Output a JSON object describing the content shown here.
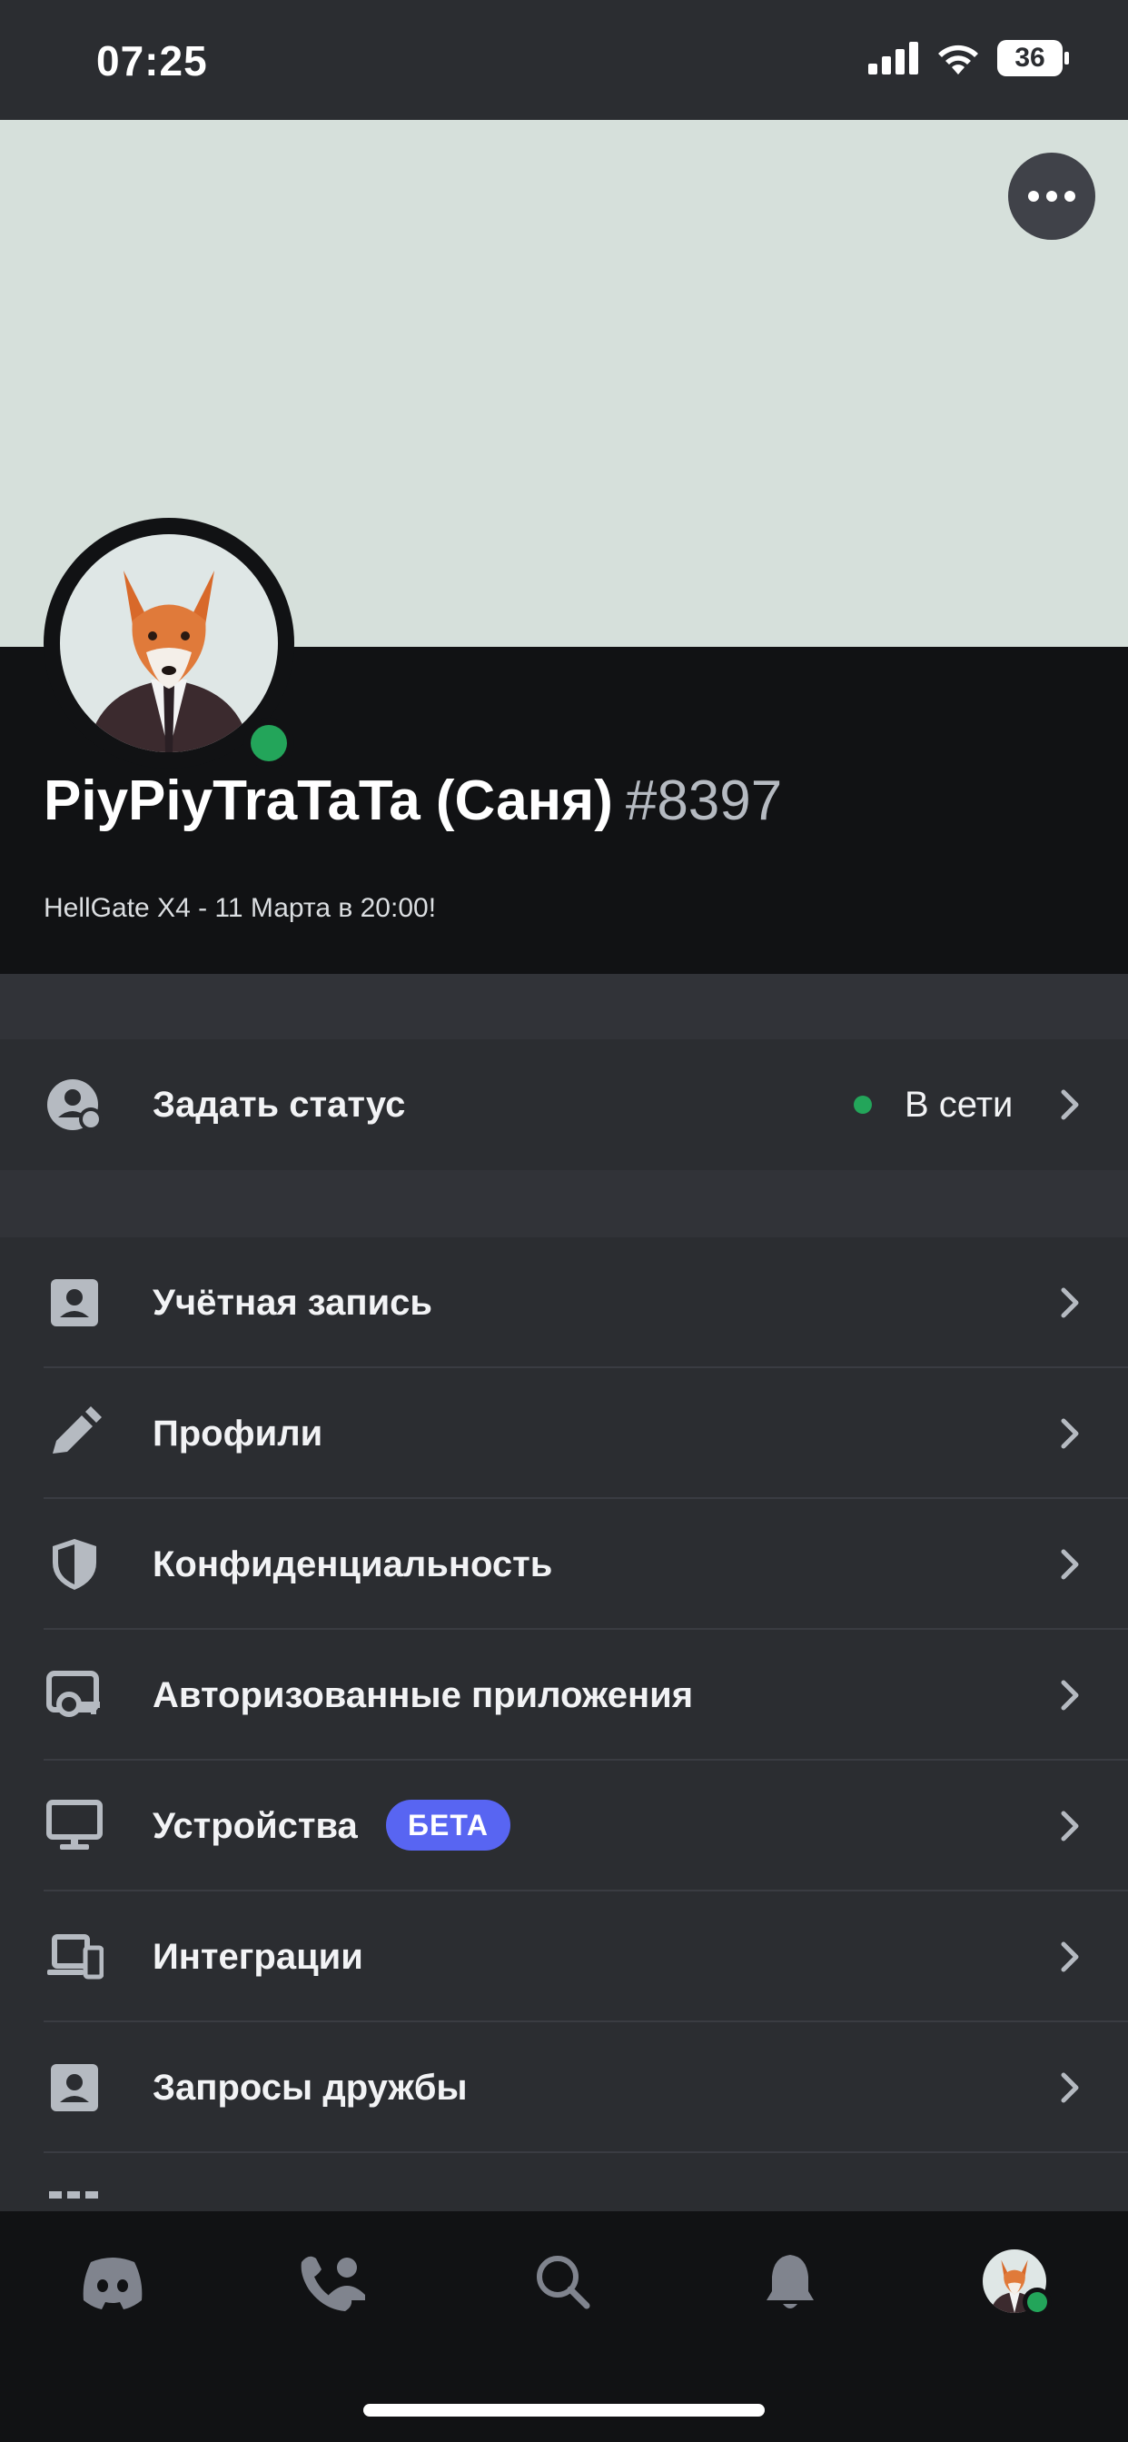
{
  "status_bar": {
    "time": "07:25",
    "battery": "36"
  },
  "profile": {
    "name": "PiyPiyTraTaTa (Саня)",
    "discriminator": "#8397",
    "custom_status": "HellGate X4 - 11 Марта в 20:00!",
    "presence_color": "#23a55a"
  },
  "status_row": {
    "label": "Задать статус",
    "value": "В сети"
  },
  "settings": [
    {
      "label": "Учётная запись",
      "icon": "account-icon"
    },
    {
      "label": "Профили",
      "icon": "pencil-icon"
    },
    {
      "label": "Конфиденциальность",
      "icon": "shield-icon"
    },
    {
      "label": "Авторизованные приложения",
      "icon": "apps-icon"
    },
    {
      "label": "Устройства",
      "icon": "monitor-icon",
      "badge": "БЕТА"
    },
    {
      "label": "Интеграции",
      "icon": "devices-icon"
    },
    {
      "label": "Запросы дружбы",
      "icon": "friend-request-icon"
    }
  ],
  "nav": [
    "home",
    "friends",
    "search",
    "notifications",
    "profile"
  ],
  "colors": {
    "accent": "#5865f2",
    "online": "#23a55a",
    "banner": "#d6e0db"
  }
}
